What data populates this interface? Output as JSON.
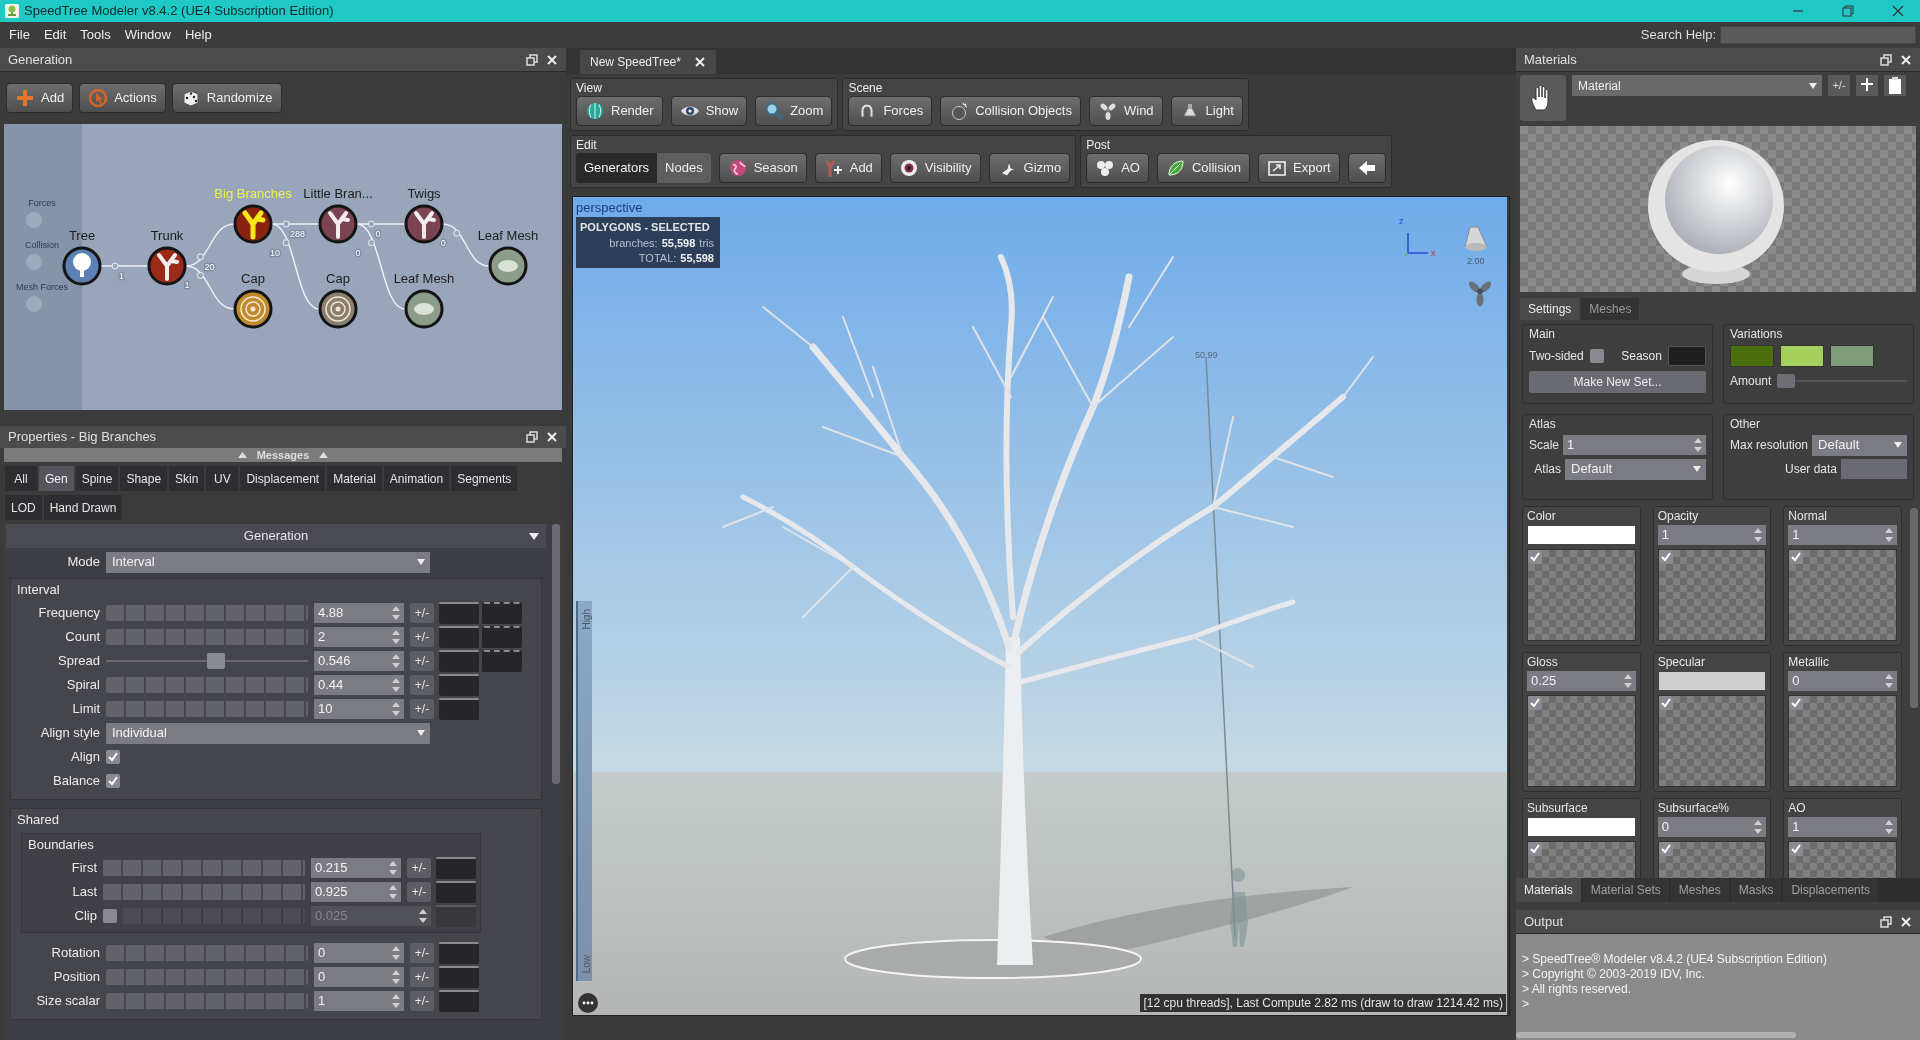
{
  "window": {
    "title": "SpeedTree Modeler v8.4.2 (UE4 Subscription Edition)"
  },
  "menu": [
    "File",
    "Edit",
    "Tools",
    "Window",
    "Help"
  ],
  "search_help": {
    "label": "Search Help:"
  },
  "generation": {
    "title": "Generation",
    "toolbar": [
      {
        "kind": "add",
        "label": "Add"
      },
      {
        "kind": "actions",
        "label": "Actions"
      },
      {
        "kind": "randomize",
        "label": "Randomize"
      }
    ],
    "side_items": [
      "Forces",
      "Collision",
      "Mesh Forces"
    ],
    "graph": {
      "label": "Tree",
      "kind": "tree",
      "selected": false,
      "color": "#5b80b4",
      "children": [
        {
          "label": "Trunk",
          "kind": "branch",
          "selected": false,
          "color": "#9c2a18",
          "link_label": "1",
          "children": [
            {
              "label": "Big Branches",
              "kind": "branch",
              "selected": true,
              "color": "#8a2410",
              "link_label": "20",
              "children": [
                {
                  "label": "Little Bran...",
                  "kind": "branch",
                  "selected": false,
                  "color": "#7c4452",
                  "link_label": "288",
                  "children": [
                    {
                      "label": "Twigs",
                      "kind": "branch",
                      "selected": false,
                      "color": "#7c4452",
                      "link_label": "0",
                      "children": [
                        {
                          "label": "Leaf Mesh",
                          "kind": "leaf",
                          "selected": false,
                          "color": "#8c9c8a",
                          "link_label": "0"
                        }
                      ]
                    },
                    {
                      "label": "Leaf Mesh",
                      "kind": "leaf",
                      "selected": false,
                      "color": "#8c9c8a",
                      "link_label": "0"
                    }
                  ]
                },
                {
                  "label": "Cap",
                  "kind": "cap",
                  "selected": false,
                  "color": "#8a8070",
                  "link_label": "10"
                }
              ]
            },
            {
              "label": "Cap",
              "kind": "cap",
              "selected": false,
              "color": "#c08a2e",
              "link_label": "1"
            }
          ]
        }
      ]
    }
  },
  "properties": {
    "title": "Properties - Big Branches",
    "messages": "Messages",
    "tabs": [
      {
        "label": "All",
        "selected": false
      },
      {
        "label": "Gen",
        "selected": true
      },
      {
        "label": "Spine",
        "selected": false
      },
      {
        "label": "Shape",
        "selected": false
      },
      {
        "label": "Skin",
        "selected": false
      },
      {
        "label": "UV",
        "selected": false
      },
      {
        "label": "Displacement",
        "selected": false
      },
      {
        "label": "Material",
        "selected": false
      },
      {
        "label": "Animation",
        "selected": false
      },
      {
        "label": "Segments",
        "selected": false
      },
      {
        "label": "LOD",
        "selected": false
      },
      {
        "label": "Hand Drawn",
        "selected": false
      }
    ],
    "section": "Generation",
    "mode": {
      "label": "Mode",
      "value": "Interval"
    },
    "groups": [
      {
        "title": "Interval",
        "rows": [
          {
            "kind": "ruler",
            "label": "Frequency",
            "value": "4.88",
            "variance": "+/-",
            "profile": true
          },
          {
            "kind": "ruler",
            "label": "Count",
            "value": "2",
            "variance": "+/-",
            "profile": true
          },
          {
            "kind": "slider",
            "label": "Spread",
            "value": "0.546",
            "level": 0.546,
            "variance": "+/-",
            "profile": true
          },
          {
            "kind": "ruler",
            "label": "Spiral",
            "value": "0.44",
            "variance": "+/-",
            "profile": false
          },
          {
            "kind": "ruler",
            "label": "Limit",
            "value": "10",
            "variance": "+/-",
            "profile": false
          },
          {
            "kind": "dropdown",
            "label": "Align style",
            "value": "Individual"
          },
          {
            "kind": "check",
            "label": "Align",
            "checked": true
          },
          {
            "kind": "check",
            "label": "Balance",
            "checked": true
          }
        ]
      },
      {
        "title": "Shared",
        "rows": [
          {
            "kind": "group",
            "title": "Boundaries",
            "rows": [
              {
                "kind": "ruler",
                "label": "First",
                "value": "0.215",
                "variance": "+/-",
                "profile": false
              },
              {
                "kind": "ruler",
                "label": "Last",
                "value": "0.925",
                "variance": "+/-",
                "profile": false
              },
              {
                "kind": "clip",
                "label": "Clip",
                "checked": false,
                "value": "0.025"
              }
            ]
          },
          {
            "kind": "ruler",
            "label": "Rotation",
            "value": "0",
            "variance": "+/-",
            "profile": false
          },
          {
            "kind": "ruler",
            "label": "Position",
            "value": "0",
            "variance": "+/-",
            "profile": false
          },
          {
            "kind": "ruler",
            "label": "Size scalar",
            "value": "1",
            "variance": "+/-",
            "profile": false
          }
        ]
      }
    ]
  },
  "document_tab": {
    "title": "New SpeedTree*"
  },
  "toolbar": [
    {
      "groups": [
        {
          "title": "View",
          "buttons": [
            {
              "kind": "render",
              "label": "Render"
            },
            {
              "kind": "show",
              "label": "Show"
            },
            {
              "kind": "zoom",
              "label": "Zoom"
            }
          ]
        },
        {
          "title": "Scene",
          "buttons": [
            {
              "kind": "forces",
              "label": "Forces"
            },
            {
              "kind": "collision_objects",
              "label": "Collision Objects"
            },
            {
              "kind": "wind",
              "label": "Wind"
            },
            {
              "kind": "light",
              "label": "Light"
            }
          ]
        }
      ]
    },
    {
      "groups": [
        {
          "title": "Edit",
          "mode_toggle": [
            {
              "label": "Generators",
              "selected": true
            },
            {
              "label": "Nodes",
              "selected": false
            }
          ],
          "buttons": [
            {
              "kind": "season",
              "label": "Season"
            },
            {
              "kind": "add_node",
              "label": "Add"
            },
            {
              "kind": "visibility",
              "label": "Visibility"
            },
            {
              "kind": "gizmo",
              "label": "Gizmo"
            }
          ]
        },
        {
          "title": "Post",
          "buttons": [
            {
              "kind": "ao",
              "label": "AO"
            },
            {
              "kind": "collision",
              "label": "Collision"
            },
            {
              "kind": "export",
              "label": "Export"
            },
            {
              "kind": "back"
            }
          ]
        }
      ]
    }
  ],
  "viewport": {
    "view": "perspective",
    "stats": {
      "title": "POLYGONS - SELECTED",
      "rows": [
        {
          "key": "branches:",
          "value": "55,598",
          "unit": "tris"
        },
        {
          "key": "TOTAL:",
          "value": "55,598"
        }
      ]
    },
    "axis": {
      "z": "z",
      "x": "x"
    },
    "light_value": "2.00",
    "height_marker": "50.99",
    "lod": {
      "high": "High",
      "low": "Low"
    },
    "status": "[12 cpu threads], Last Compute 2.82 ms (draw to draw 1214.42 ms)"
  },
  "materials": {
    "title": "Materials",
    "material": "Material",
    "variance": "+/-",
    "tabs": [
      {
        "label": "Settings",
        "selected": true
      },
      {
        "label": "Meshes",
        "selected": false
      }
    ],
    "main": {
      "title": "Main",
      "two_sided": {
        "label": "Two-sided",
        "checked": false
      },
      "season": {
        "label": "Season",
        "color": "#1e1e1e"
      },
      "button": "Make New Set..."
    },
    "variations": {
      "title": "Variations",
      "swatches": [
        {
          "color": "#4a6e0c"
        },
        {
          "color": "#a6d05c"
        },
        {
          "color": "#7e9c78"
        }
      ],
      "amount": {
        "label": "Amount",
        "level": 0
      }
    },
    "atlas": {
      "title": "Atlas",
      "scale": {
        "label": "Scale",
        "value": "1"
      },
      "atlas": {
        "label": "Atlas",
        "value": "Default"
      }
    },
    "other": {
      "title": "Other",
      "max_resolution": {
        "label": "Max resolution",
        "value": "Default"
      },
      "user_data": {
        "label": "User data"
      }
    },
    "maps": [
      {
        "label": "Color",
        "kind": "swatch",
        "color": "#ffffff",
        "checked": true
      },
      {
        "label": "Opacity",
        "kind": "number",
        "value": "1",
        "checked": true
      },
      {
        "label": "Normal",
        "kind": "number",
        "value": "1",
        "checked": true
      },
      {
        "label": "Gloss",
        "kind": "number",
        "value": "0.25",
        "checked": true
      },
      {
        "label": "Specular",
        "kind": "swatch",
        "color": "#cfcfcf",
        "checked": true
      },
      {
        "label": "Metallic",
        "kind": "number",
        "value": "0",
        "checked": true
      },
      {
        "label": "Subsurface",
        "kind": "swatch",
        "color": "#ffffff",
        "checked": true
      },
      {
        "label": "Subsurface%",
        "kind": "number",
        "value": "0",
        "checked": true
      },
      {
        "label": "AO",
        "kind": "number",
        "value": "1",
        "checked": true
      }
    ],
    "bottom_tabs": [
      {
        "label": "Materials",
        "selected": true
      },
      {
        "label": "Material Sets",
        "selected": false
      },
      {
        "label": "Meshes",
        "selected": false
      },
      {
        "label": "Masks",
        "selected": false
      },
      {
        "label": "Displacements",
        "selected": false
      }
    ]
  },
  "output": {
    "title": "Output",
    "lines": [
      "> SpeedTree® Modeler v8.4.2 (UE4 Subscription Edition)",
      "> Copyright © 2003-2019 IDV, Inc.",
      "> All rights reserved.",
      ">"
    ]
  }
}
